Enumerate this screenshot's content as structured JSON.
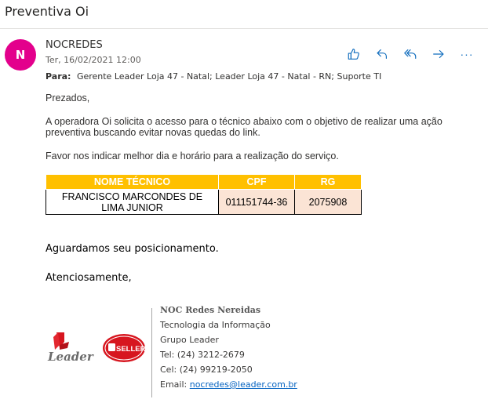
{
  "subject": "Preventiva Oi",
  "sender": {
    "initial": "N",
    "name": "NOCREDES",
    "date": "Ter, 16/02/2021 12:00",
    "to_label": "Para:",
    "recipients": "Gerente Leader Loja 47 - Natal; Leader Loja 47 - Natal - RN; Suporte TI"
  },
  "actions": {
    "like_icon": "thumbs-up-icon",
    "reply_icon": "reply-icon",
    "reply_all_icon": "reply-all-icon",
    "forward_icon": "forward-icon",
    "more_label": "···"
  },
  "body": {
    "greeting": "Prezados,",
    "para1_line1": "A operadora Oi solicita o acesso para o técnico abaixo com o objetivo de realizar uma ação",
    "para1_line2": "preventiva buscando evitar novas quedas do link.",
    "para2": "Favor nos indicar melhor dia e horário para a realização do serviço.",
    "closing1": "Aguardamos seu posicionamento.",
    "closing2": "Atenciosamente,"
  },
  "table": {
    "headers": [
      "NOME TÉCNICO",
      "CPF",
      "RG"
    ],
    "row": {
      "name_line1": "FRANCISCO MARCONDES DE",
      "name_line2": "LIMA JUNIOR",
      "cpf": "011151744-36",
      "rg": "2075908"
    },
    "header_color": "#ffc000",
    "cell_color": "#fbe4d5"
  },
  "signature": {
    "name": "NOC Redes Nereidas",
    "dept": "Tecnologia da Informação",
    "group": "Grupo Leader",
    "tel": "Tel: (24) 3212-2679",
    "cel": "Cel: (24) 99219-2050",
    "email_label": "Email:",
    "email": "nocredes@leader.com.br",
    "logo_leader": "Leader",
    "logo_seller": "SELLER"
  },
  "colors": {
    "avatar": "#e3008c",
    "accent": "#0f6cbd"
  }
}
